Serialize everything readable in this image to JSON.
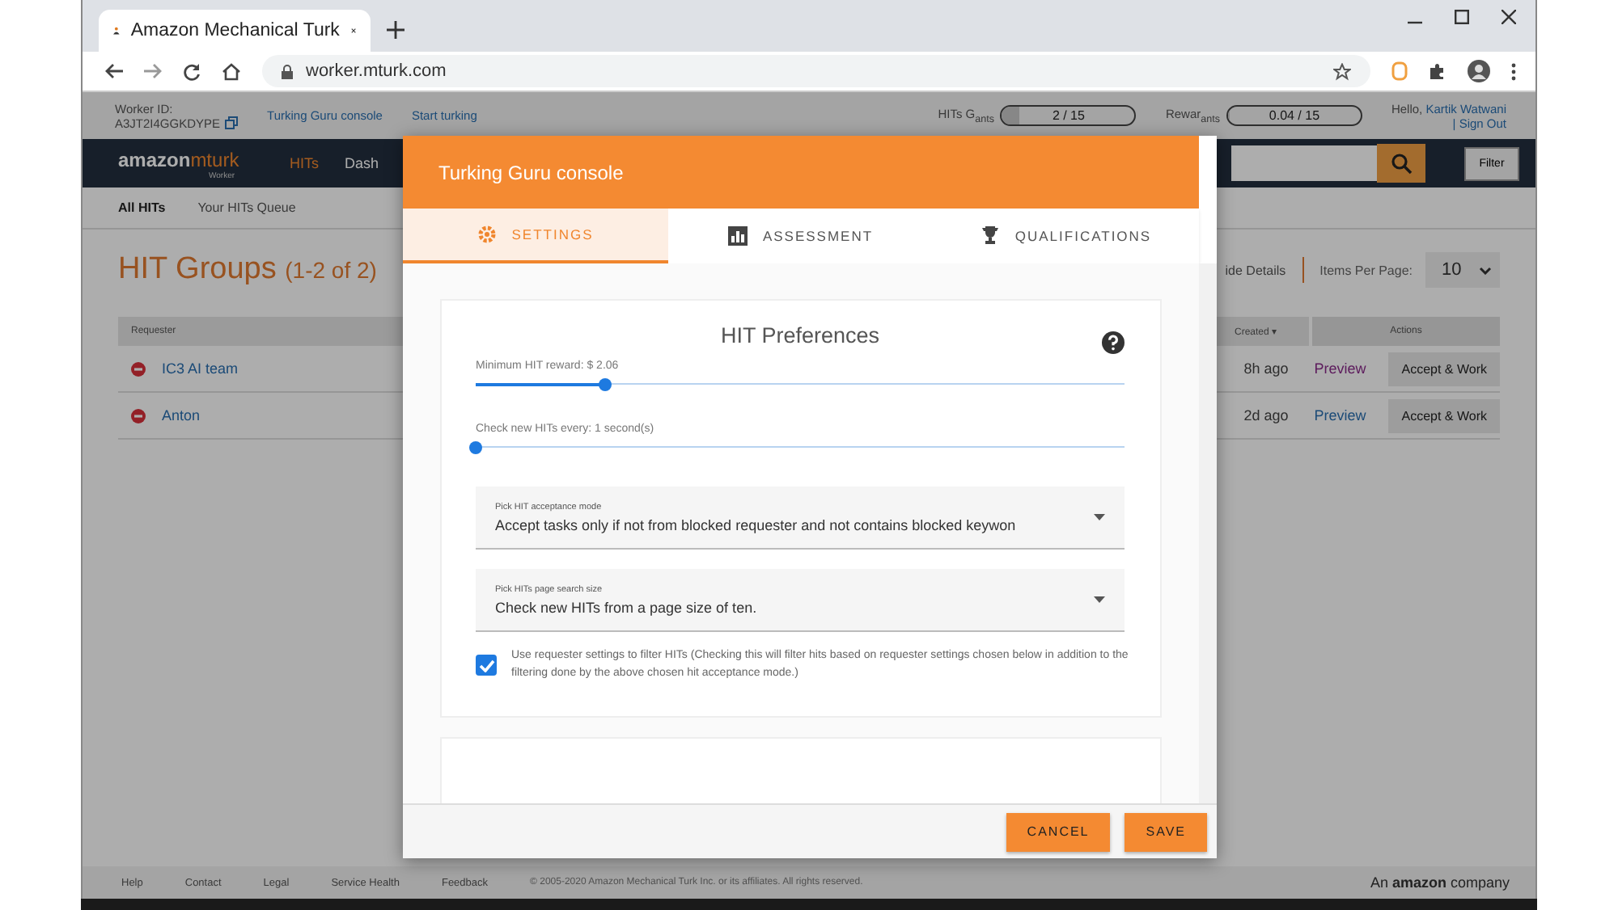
{
  "browser": {
    "tab_title": "Amazon Mechanical Turk",
    "url": "worker.mturk.com"
  },
  "worker_bar": {
    "worker_id_label": "Worker ID:",
    "worker_id": "A3JT2I4GGKDYPE",
    "links": [
      "Turking Guru console",
      "Start turking"
    ],
    "goals": [
      {
        "label": "HITs G$_{ants}$",
        "reading": "2 / 15",
        "level": 0.13
      },
      {
        "label": "Rewar$_{ants}$",
        "reading": "0.04 / 15",
        "level": 0.01
      }
    ],
    "greeting": "Hello,",
    "user": "Kartik Watwani",
    "sign_out": "| Sign Out"
  },
  "nav": {
    "logo": "amazon",
    "logo_accent": "mturk",
    "logo_sub": "Worker",
    "items": [
      {
        "label": "HITs",
        "selected": true
      },
      {
        "label": "Dash",
        "selected": false
      }
    ],
    "filter": "Filter"
  },
  "subnav": [
    {
      "label": "All HITs",
      "selected": true
    },
    {
      "label": "Your HITs Queue",
      "selected": false
    }
  ],
  "heading": {
    "title": "HIT Groups",
    "count": "(1-2 of 2)"
  },
  "controls": {
    "details": "ide Details",
    "per_page_label": "Items Per Page:",
    "per_page": "10"
  },
  "table": {
    "columns": [
      "Requester",
      "Created ▾",
      "Actions"
    ],
    "rows": [
      {
        "requester": "IC3 AI team",
        "created": "8h ago",
        "preview": "Preview",
        "visited": true,
        "action": "Accept & Work"
      },
      {
        "requester": "Anton",
        "created": "2d ago",
        "preview": "Preview",
        "visited": false,
        "action": "Accept & Work"
      }
    ]
  },
  "footer": {
    "links": [
      "Help",
      "Contact",
      "Legal",
      "Service Health",
      "Feedback"
    ],
    "copyright": "© 2005-2020 Amazon Mechanical Turk Inc. or its affiliates. All rights reserved.",
    "brand_prefix": "An",
    "brand": "amazon",
    "brand_suffix": "company"
  },
  "modal": {
    "title": "Turking Guru console",
    "tabs": [
      {
        "label": "SETTINGS",
        "kind": "gear",
        "selected": true
      },
      {
        "label": "ASSESSMENT",
        "kind": "chart",
        "selected": false
      },
      {
        "label": "QUALIFICATIONS",
        "kind": "trophy",
        "selected": false
      }
    ],
    "card_title": "HIT Preferences",
    "sliders": [
      {
        "label": "Minimum HIT reward: $ 2.06",
        "level": 0.2
      },
      {
        "label": "Check new HITs every: 1 second(s)",
        "level": 0
      }
    ],
    "selects": [
      {
        "label": "Pick HIT acceptance mode",
        "value": "Accept tasks only if not from blocked requester and not contains blocked keywon"
      },
      {
        "label": "Pick HITs page search size",
        "value": "Check new HITs from a page size of ten."
      }
    ],
    "checkbox": {
      "label": "Use requester settings to filter HITs (Checking this will filter hits based on requester settings chosen below in addition to the filtering done by the above chosen hit acceptance mode.)",
      "checked": true
    },
    "buttons": [
      "CANCEL",
      "SAVE"
    ]
  }
}
